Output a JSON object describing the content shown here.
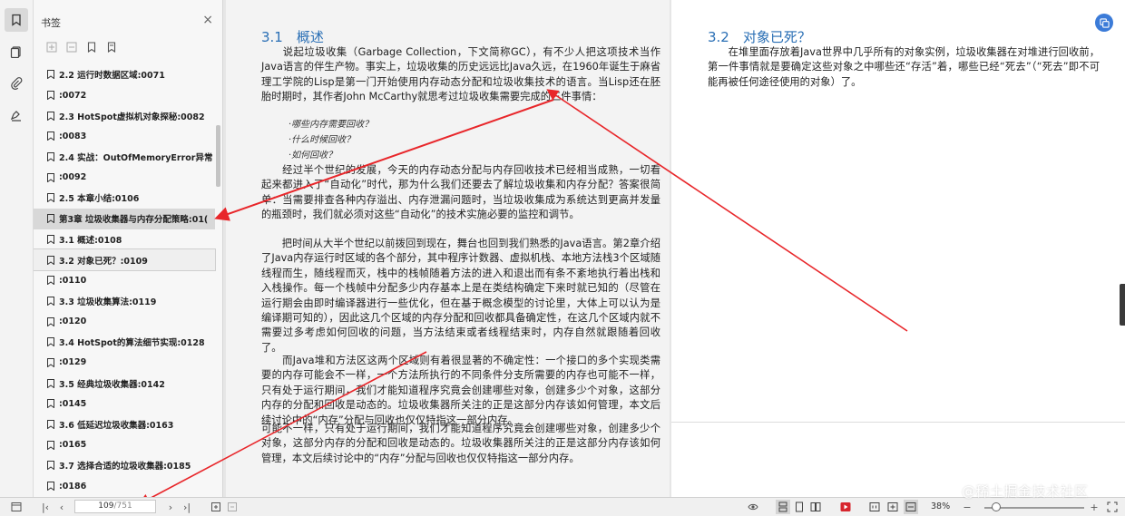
{
  "sidebar_rail": {
    "icons": [
      "bookmark-icon",
      "thumbnail-icon",
      "attachment-icon",
      "signature-icon"
    ]
  },
  "bookmarks": {
    "title": "书签",
    "close": "×",
    "items": [
      {
        "label": "2.2 运行时数据区域:0071"
      },
      {
        "label": ":0072"
      },
      {
        "label": "2.3 HotSpot虚拟机对象探秘:0082"
      },
      {
        "label": ":0083"
      },
      {
        "label": "2.4 实战：OutOfMemoryError异常"
      },
      {
        "label": ":0092"
      },
      {
        "label": "2.5 本章小结:0106"
      },
      {
        "label": "第3章 垃圾收集器与内存分配策略:01("
      },
      {
        "label": "3.1 概述:0108"
      },
      {
        "label": "3.2 对象已死？:0109"
      },
      {
        "label": ":0110"
      },
      {
        "label": "3.3 垃圾收集算法:0119"
      },
      {
        "label": ":0120"
      },
      {
        "label": "3.4 HotSpot的算法细节实现:0128"
      },
      {
        "label": ":0129"
      },
      {
        "label": "3.5 经典垃圾收集器:0142"
      },
      {
        "label": ":0145"
      },
      {
        "label": "3.6 低延迟垃圾收集器:0163"
      },
      {
        "label": ":0165"
      },
      {
        "label": "3.7 选择合适的垃圾收集器:0185"
      },
      {
        "label": ":0186"
      }
    ]
  },
  "left_page": {
    "section_title": "3.1　概述",
    "p1": "　　说起垃圾收集（Garbage Collection，下文简称GC），有不少人把这项技术当作Java语言的伴生产物。事实上，垃圾收集的历史远远比Java久远，在1960年诞生于麻省理工学院的Lisp是第一门开始使用内存动态分配和垃圾收集技术的语言。当Lisp还在胚胎时期时，其作者John McCarthy就思考过垃圾收集需要完成的三件事情：",
    "questions": [
      "·哪些内存需要回收？",
      "·什么时候回收？",
      "·如何回收？"
    ],
    "p2": "　　经过半个世纪的发展，今天的内存动态分配与内存回收技术已经相当成熟，一切看起来都进入了“自动化”时代，那为什么我们还要去了解垃圾收集和内存分配？答案很简单：当需要排查各种内存溢出、内存泄漏问题时，当垃圾收集成为系统达到更高并发量的瓶颈时，我们就必须对这些“自动化”的技术实施必要的监控和调节。",
    "p3": "　　把时间从大半个世纪以前拨回到现在，舞台也回到我们熟悉的Java语言。第2章介绍了Java内存运行时区域的各个部分，其中程序计数器、虚拟机栈、本地方法栈3个区域随线程而生，随线程而灭，栈中的栈帧随着方法的进入和退出而有条不紊地执行着出栈和入栈操作。每一个栈帧中分配多少内存基本上是在类结构确定下来时就已知的（尽管在运行期会由即时编译器进行一些优化，但在基于概念模型的讨论里，大体上可以认为是编译期可知的），因此这几个区域的内存分配和回收都具备确定性，在这几个区域内就不需要过多考虑如何回收的问题，当方法结束或者线程结束时，内存自然就跟随着回收了。",
    "p4": "　　而Java堆和方法区这两个区域则有着很显著的不确定性：一个接口的多个实现类需要的内存可能会不一样，一个方法所执行的不同条件分支所需要的内存也可能不一样，只有处于运行期间，我们才能知道程序究竟会创建哪些对象，创建多少个对象，这部分内存的分配和回收是动态的。垃圾收集器所关注的正是这部分内存该如何管理，本文后续讨论中的“内存”分配与回收也仅仅特指这一部分内存。",
    "p4_dup": "可能不一样，只有处于运行期间，我们才能知道程序究竟会创建哪些对象，创建多少个对象，这部分内存的分配和回收是动态的。垃圾收集器所关注的正是这部分内存该如何管理，本文后续讨论中的“内存”分配与回收也仅仅特指这一部分内存。"
  },
  "right_page": {
    "section_title": "3.2　对象已死？",
    "p1": "　　在堆里面存放着Java世界中几乎所有的对象实例，垃圾收集器在对堆进行回收前，第一件事情就是要确定这些对象之中哪些还“存活”着，哪些已经“死去”（“死去”即不可能再被任何途径使用的对象）了。"
  },
  "statusbar": {
    "page_current": "109",
    "page_total": "/751",
    "zoom": "38%",
    "zoom_minus": "−",
    "zoom_plus": "+",
    "zoom_fraction": 0.12
  },
  "watermark": "@稀土掘金技术社区",
  "colors": {
    "accent_blue": "#2a6fb5",
    "annotation_red": "#e8262a",
    "float_button": "#3b7bd8"
  }
}
